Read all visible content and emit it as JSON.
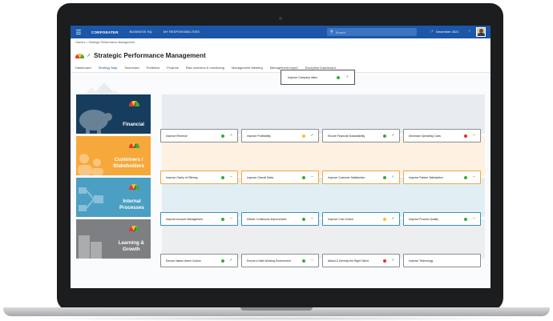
{
  "topbar": {
    "brand": "CORPORATER",
    "brand_sub": "",
    "nav": [
      "BUSINESS HQ",
      "MY RESPONSIBILITIES"
    ],
    "search_placeholder": "Search",
    "date": "December 2021",
    "accent": "#1b56a8"
  },
  "breadcrumb": "Owners > Strategic Performance Management",
  "page": {
    "title": "Strategic Performance Management",
    "tabs": [
      "Dashboard",
      "Strategy Map",
      "Scorecard",
      "Portfolios",
      "Projects",
      "Risk overview & monitoring",
      "Management Meeting",
      "Management report",
      "Exception Dashboard"
    ],
    "active_tab": "Strategy Map"
  },
  "top_objective": {
    "label": "Improve Company Value",
    "status": "green",
    "icon": "pin-icon"
  },
  "perspectives": [
    {
      "label_1": "Financial",
      "label_2": "",
      "color": "#173d5e",
      "icon": "piggy-bank-icon"
    },
    {
      "label_1": "Customers /",
      "label_2": "Stakeholders",
      "color": "#f6a83b",
      "icon": "people-icon"
    },
    {
      "label_1": "Internal",
      "label_2": "Processes",
      "color": "#4a9fc2",
      "icon": "process-icon"
    },
    {
      "label_1": "Learning &",
      "label_2": "Growth",
      "color": "#7d7f82",
      "icon": "building-icon"
    }
  ],
  "objectives": {
    "financial": [
      {
        "label": "Improve Revenue",
        "status": "green",
        "icon": "pin-icon"
      },
      {
        "label": "Improve Profitability",
        "status": "yellow",
        "icon": "pin-icon"
      },
      {
        "label": "Ensure Financial Sustainability",
        "status": "green",
        "icon": "pin-icon"
      },
      {
        "label": "Decrease Operating Costs",
        "status": "red",
        "icon": "arrow-icon"
      }
    ],
    "customers": [
      {
        "label": "Improve Clarity of Offering",
        "status": "green",
        "icon": "arrow-icon"
      },
      {
        "label": "Improve Overall Sales",
        "status": "green",
        "icon": "arrow-icon"
      },
      {
        "label": "Improve Customer Satisfaction",
        "status": "green",
        "icon": "pin-icon"
      },
      {
        "label": "Improve Partner Satisfaction",
        "status": "green",
        "icon": "arrow-icon"
      }
    ],
    "internal": [
      {
        "label": "Improve Account Management",
        "status": "green",
        "icon": "arrow-icon"
      },
      {
        "label": "Deliver Continuous Improvement",
        "status": "green",
        "icon": "arrow-icon"
      },
      {
        "label": "Improve Cost Control",
        "status": "yellow",
        "icon": "pin-icon"
      },
      {
        "label": "Improve Process Quality",
        "status": "green",
        "icon": "arrow-icon"
      }
    ],
    "learning": [
      {
        "label": "Ensure Values driven Culture",
        "status": "green",
        "icon": "pin-icon"
      },
      {
        "label": "Ensure a Safe Working Environment",
        "status": "green",
        "icon": "arrow-icon"
      },
      {
        "label": "Attract & Develop the Right Talent",
        "status": "red",
        "icon": "pin-icon"
      },
      {
        "label": "Improve Technology",
        "status": "",
        "icon": ""
      }
    ]
  }
}
